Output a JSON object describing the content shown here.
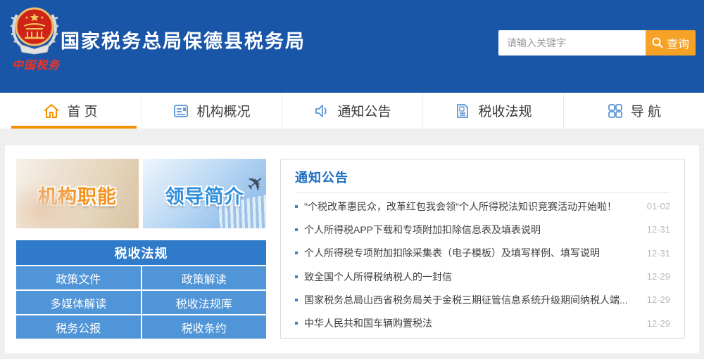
{
  "colors": {
    "header_bg": "#1a56a8",
    "accent_orange": "#f39000",
    "search_button_orange": "#f5a227",
    "nav_icon_blue": "#6a9fd8",
    "notices_title_blue": "#1c6ec2",
    "table_header_blue": "#2f7ac9",
    "table_cell_blue": "#5095d8"
  },
  "header": {
    "logo_icon": "tax-emblem-icon",
    "logo_caption": "中国税务",
    "site_title": "国家税务总局保德县税务局",
    "search": {
      "placeholder": "请输入关键字",
      "button_label": "查询"
    }
  },
  "nav": {
    "items": [
      {
        "label": "首 页",
        "icon": "home-icon",
        "active": true
      },
      {
        "label": "机构概况",
        "icon": "org-profile-icon",
        "active": false
      },
      {
        "label": "通知公告",
        "icon": "announcement-icon",
        "active": false
      },
      {
        "label": "税收法规",
        "icon": "tax-law-doc-icon",
        "active": false
      },
      {
        "label": "导 航",
        "icon": "grid-nav-icon",
        "active": false
      }
    ]
  },
  "main": {
    "banners": [
      {
        "label": "机构职能"
      },
      {
        "label": "领导简介"
      }
    ],
    "law_table": {
      "title": "税收法规",
      "cells": [
        [
          "政策文件",
          "政策解读"
        ],
        [
          "多媒体解读",
          "税收法规库"
        ],
        [
          "税务公报",
          "税收条约"
        ]
      ]
    },
    "notices": {
      "title": "通知公告",
      "items": [
        {
          "text": "\"个税改革惠民众，改革红包我会领\"个人所得税法知识竞赛活动开始啦！",
          "date": "01-02"
        },
        {
          "text": "个人所得税APP下载和专项附加扣除信息表及填表说明",
          "date": "12-31"
        },
        {
          "text": "个人所得税专项附加扣除采集表（电子模板）及填写样例、填写说明",
          "date": "12-31"
        },
        {
          "text": "致全国个人所得税纳税人的一封信",
          "date": "12-29"
        },
        {
          "text": "国家税务总局山西省税务局关于金税三期征管信息系统升级期间纳税人端...",
          "date": "12-29"
        },
        {
          "text": "中华人民共和国车辆购置税法",
          "date": "12-29"
        }
      ]
    }
  }
}
